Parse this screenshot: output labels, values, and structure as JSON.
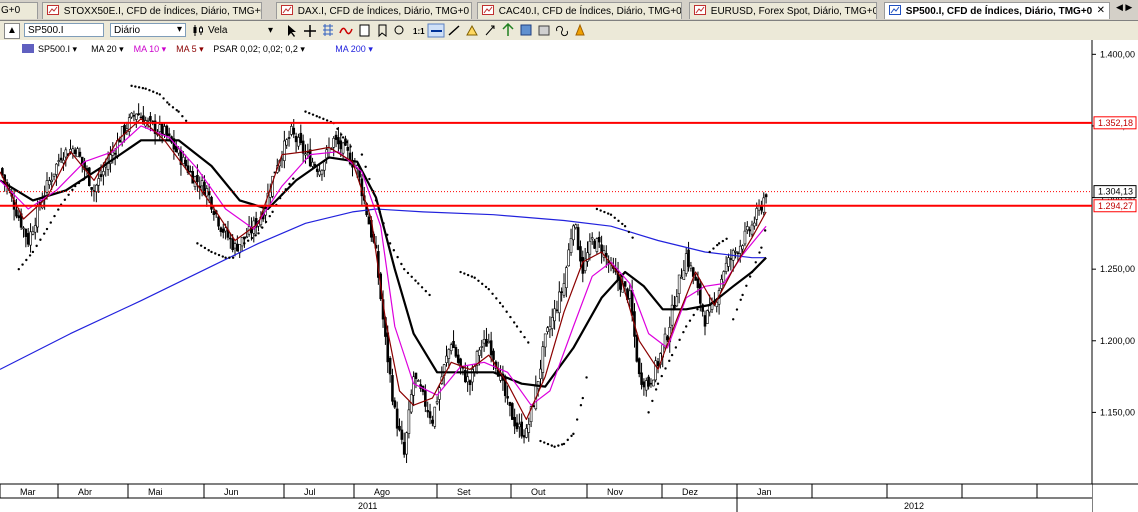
{
  "tabs": [
    {
      "label": "G+0",
      "active": false
    },
    {
      "label": "STOXX50E.I, CFD de Índices, Diário, TMG+0",
      "active": false
    },
    {
      "label": "DAX.I, CFD de Índices, Diário, TMG+0",
      "active": false
    },
    {
      "label": "CAC40.I, CFD de Índices, Diário, TMG+0",
      "active": false
    },
    {
      "label": "EURUSD, Forex Spot, Diário, TMG+0",
      "active": false
    },
    {
      "label": "SP500.I, CFD de Índices, Diário, TMG+0",
      "active": true
    }
  ],
  "tab_close": "✕",
  "nav_arrows": "◀ ▶",
  "toolbar": {
    "symbol": "SP500.I",
    "period": "Diário",
    "chart_type": "Vela",
    "collapse_icon": "▲",
    "tool_icons": [
      "cursor-icon",
      "crosshair-icon",
      "grid-icon",
      "wave-icon",
      "info-icon",
      "bookmark-icon",
      "zoom-icon",
      "ratio-icon",
      "line-icon",
      "draw-icon",
      "object-icon",
      "arrows-icon",
      "scale-icon",
      "save-icon",
      "compare-icon",
      "link-icon",
      "alert-icon"
    ]
  },
  "legend": [
    {
      "text": "SP500.I",
      "color": "#000000"
    },
    {
      "text": "MA 20",
      "color": "#000000"
    },
    {
      "text": "MA 10",
      "color": "#cc00cc"
    },
    {
      "text": "MA 5",
      "color": "#8b0000"
    },
    {
      "text": "PSAR 0,02; 0,02; 0,2",
      "color": "#000000"
    },
    {
      "text": "MA 200",
      "color": "#2222dd"
    }
  ],
  "chart_data": {
    "type": "candlestick",
    "price_range": [
      1100,
      1410
    ],
    "y_ticks": [
      {
        "value": 1400,
        "label": "1.400,00"
      },
      {
        "value": 1350,
        "label": "1.350,00"
      },
      {
        "value": 1300,
        "label": "1.300,00"
      },
      {
        "value": 1250,
        "label": "1.250,00"
      },
      {
        "value": 1200,
        "label": "1.200,00"
      },
      {
        "value": 1150,
        "label": "1.150,00"
      }
    ],
    "horizontal_lines": [
      {
        "value": 1352.18,
        "label": "1.352,18",
        "style": "solid",
        "color": "#ff0000"
      },
      {
        "value": 1294.27,
        "label": "1.294,27",
        "style": "solid",
        "color": "#ff0000"
      },
      {
        "value": 1304.13,
        "label": "1.304,13",
        "style": "dotted",
        "color": "#ff0000"
      }
    ],
    "months": [
      "Mar",
      "Abr",
      "Mai",
      "Jun",
      "Jul",
      "Ago",
      "Set",
      "Out",
      "Nov",
      "Dez",
      "Jan"
    ],
    "years": [
      "2011",
      "2012"
    ],
    "close_path": [
      [
        0,
        1320
      ],
      [
        6,
        1295
      ],
      [
        12,
        1270
      ],
      [
        18,
        1300
      ],
      [
        26,
        1330
      ],
      [
        32,
        1335
      ],
      [
        40,
        1305
      ],
      [
        46,
        1325
      ],
      [
        52,
        1345
      ],
      [
        58,
        1360
      ],
      [
        64,
        1350
      ],
      [
        70,
        1345
      ],
      [
        76,
        1330
      ],
      [
        82,
        1315
      ],
      [
        88,
        1305
      ],
      [
        94,
        1280
      ],
      [
        100,
        1265
      ],
      [
        106,
        1275
      ],
      [
        112,
        1290
      ],
      [
        118,
        1325
      ],
      [
        124,
        1345
      ],
      [
        130,
        1330
      ],
      [
        136,
        1320
      ],
      [
        142,
        1340
      ],
      [
        148,
        1330
      ],
      [
        152,
        1320
      ],
      [
        156,
        1290
      ],
      [
        160,
        1260
      ],
      [
        164,
        1200
      ],
      [
        168,
        1150
      ],
      [
        172,
        1120
      ],
      [
        176,
        1175
      ],
      [
        180,
        1160
      ],
      [
        184,
        1145
      ],
      [
        188,
        1175
      ],
      [
        192,
        1200
      ],
      [
        196,
        1180
      ],
      [
        200,
        1170
      ],
      [
        204,
        1195
      ],
      [
        208,
        1200
      ],
      [
        212,
        1180
      ],
      [
        216,
        1155
      ],
      [
        220,
        1140
      ],
      [
        224,
        1135
      ],
      [
        228,
        1165
      ],
      [
        232,
        1200
      ],
      [
        236,
        1220
      ],
      [
        240,
        1240
      ],
      [
        244,
        1285
      ],
      [
        248,
        1250
      ],
      [
        252,
        1270
      ],
      [
        256,
        1265
      ],
      [
        260,
        1250
      ],
      [
        264,
        1240
      ],
      [
        268,
        1230
      ],
      [
        272,
        1175
      ],
      [
        276,
        1170
      ],
      [
        280,
        1185
      ],
      [
        284,
        1205
      ],
      [
        288,
        1235
      ],
      [
        292,
        1260
      ],
      [
        296,
        1240
      ],
      [
        300,
        1215
      ],
      [
        304,
        1225
      ],
      [
        308,
        1250
      ],
      [
        312,
        1260
      ],
      [
        316,
        1270
      ],
      [
        320,
        1280
      ],
      [
        324,
        1295
      ],
      [
        326,
        1304
      ]
    ],
    "ma5": [
      [
        0,
        1318
      ],
      [
        10,
        1285
      ],
      [
        20,
        1300
      ],
      [
        30,
        1332
      ],
      [
        40,
        1312
      ],
      [
        50,
        1340
      ],
      [
        60,
        1355
      ],
      [
        70,
        1340
      ],
      [
        80,
        1318
      ],
      [
        90,
        1295
      ],
      [
        100,
        1270
      ],
      [
        110,
        1282
      ],
      [
        120,
        1330
      ],
      [
        130,
        1332
      ],
      [
        140,
        1335
      ],
      [
        150,
        1325
      ],
      [
        158,
        1285
      ],
      [
        164,
        1215
      ],
      [
        170,
        1165
      ],
      [
        176,
        1155
      ],
      [
        184,
        1160
      ],
      [
        192,
        1185
      ],
      [
        200,
        1180
      ],
      [
        208,
        1190
      ],
      [
        216,
        1170
      ],
      [
        224,
        1145
      ],
      [
        232,
        1175
      ],
      [
        240,
        1220
      ],
      [
        248,
        1255
      ],
      [
        256,
        1262
      ],
      [
        264,
        1245
      ],
      [
        272,
        1200
      ],
      [
        280,
        1180
      ],
      [
        288,
        1215
      ],
      [
        296,
        1248
      ],
      [
        304,
        1225
      ],
      [
        312,
        1250
      ],
      [
        320,
        1272
      ],
      [
        326,
        1290
      ]
    ],
    "ma10": [
      [
        0,
        1312
      ],
      [
        12,
        1292
      ],
      [
        24,
        1305
      ],
      [
        36,
        1325
      ],
      [
        48,
        1332
      ],
      [
        60,
        1350
      ],
      [
        72,
        1342
      ],
      [
        84,
        1320
      ],
      [
        96,
        1292
      ],
      [
        108,
        1278
      ],
      [
        120,
        1308
      ],
      [
        132,
        1330
      ],
      [
        144,
        1332
      ],
      [
        154,
        1318
      ],
      [
        162,
        1280
      ],
      [
        168,
        1210
      ],
      [
        176,
        1170
      ],
      [
        186,
        1162
      ],
      [
        196,
        1182
      ],
      [
        206,
        1185
      ],
      [
        216,
        1178
      ],
      [
        226,
        1155
      ],
      [
        234,
        1165
      ],
      [
        244,
        1210
      ],
      [
        252,
        1245
      ],
      [
        260,
        1255
      ],
      [
        268,
        1240
      ],
      [
        276,
        1205
      ],
      [
        284,
        1195
      ],
      [
        292,
        1230
      ],
      [
        300,
        1238
      ],
      [
        308,
        1240
      ],
      [
        316,
        1260
      ],
      [
        326,
        1280
      ]
    ],
    "ma20": [
      [
        0,
        1312
      ],
      [
        14,
        1298
      ],
      [
        28,
        1305
      ],
      [
        44,
        1322
      ],
      [
        60,
        1340
      ],
      [
        76,
        1340
      ],
      [
        90,
        1322
      ],
      [
        102,
        1298
      ],
      [
        114,
        1292
      ],
      [
        126,
        1312
      ],
      [
        140,
        1328
      ],
      [
        152,
        1325
      ],
      [
        160,
        1300
      ],
      [
        168,
        1250
      ],
      [
        176,
        1205
      ],
      [
        186,
        1178
      ],
      [
        198,
        1178
      ],
      [
        210,
        1178
      ],
      [
        222,
        1170
      ],
      [
        232,
        1168
      ],
      [
        244,
        1195
      ],
      [
        256,
        1230
      ],
      [
        266,
        1248
      ],
      [
        274,
        1238
      ],
      [
        282,
        1222
      ],
      [
        292,
        1222
      ],
      [
        302,
        1225
      ],
      [
        312,
        1238
      ],
      [
        320,
        1248
      ],
      [
        326,
        1258
      ]
    ],
    "ma200": [
      [
        0,
        1180
      ],
      [
        30,
        1205
      ],
      [
        60,
        1228
      ],
      [
        90,
        1252
      ],
      [
        110,
        1268
      ],
      [
        130,
        1282
      ],
      [
        150,
        1290
      ],
      [
        160,
        1292
      ],
      [
        180,
        1290
      ],
      [
        210,
        1288
      ],
      [
        240,
        1284
      ],
      [
        260,
        1280
      ],
      [
        280,
        1270
      ],
      [
        300,
        1262
      ],
      [
        320,
        1258
      ],
      [
        326,
        1258
      ]
    ],
    "psar_segments": [
      {
        "points": [
          [
            8,
            1250
          ],
          [
            14,
            1262
          ],
          [
            20,
            1278
          ],
          [
            26,
            1295
          ],
          [
            32,
            1308
          ],
          [
            38,
            1316
          ]
        ],
        "side": "below"
      },
      {
        "points": [
          [
            56,
            1378
          ],
          [
            62,
            1376
          ],
          [
            68,
            1372
          ],
          [
            72,
            1365
          ],
          [
            76,
            1360
          ],
          [
            80,
            1352
          ]
        ],
        "side": "above"
      },
      {
        "points": [
          [
            84,
            1268
          ],
          [
            90,
            1262
          ],
          [
            96,
            1258
          ],
          [
            100,
            1258
          ]
        ],
        "side": "below"
      },
      {
        "points": [
          [
            104,
            1268
          ],
          [
            110,
            1275
          ],
          [
            116,
            1290
          ],
          [
            120,
            1302
          ],
          [
            126,
            1316
          ]
        ],
        "side": "below"
      },
      {
        "points": [
          [
            130,
            1360
          ],
          [
            136,
            1356
          ],
          [
            142,
            1352
          ],
          [
            146,
            1342
          ],
          [
            150,
            1334
          ]
        ],
        "side": "above"
      },
      {
        "points": [
          [
            154,
            1330
          ],
          [
            160,
            1298
          ],
          [
            166,
            1268
          ],
          [
            172,
            1250
          ],
          [
            178,
            1240
          ],
          [
            184,
            1230
          ]
        ],
        "side": "above"
      },
      {
        "points": [
          [
            196,
            1248
          ],
          [
            202,
            1244
          ],
          [
            208,
            1236
          ],
          [
            214,
            1224
          ],
          [
            220,
            1210
          ],
          [
            226,
            1196
          ]
        ],
        "side": "above"
      },
      {
        "points": [
          [
            230,
            1130
          ],
          [
            236,
            1126
          ],
          [
            240,
            1128
          ],
          [
            244,
            1135
          ],
          [
            248,
            1160
          ],
          [
            250,
            1178
          ]
        ],
        "side": "below"
      },
      {
        "points": [
          [
            254,
            1292
          ],
          [
            260,
            1288
          ],
          [
            266,
            1280
          ],
          [
            270,
            1270
          ]
        ],
        "side": "above"
      },
      {
        "points": [
          [
            276,
            1150
          ],
          [
            280,
            1170
          ],
          [
            286,
            1190
          ],
          [
            292,
            1210
          ],
          [
            298,
            1225
          ]
        ],
        "side": "below"
      },
      {
        "points": [
          [
            302,
            1262
          ],
          [
            306,
            1268
          ],
          [
            310,
            1272
          ]
        ],
        "side": "above"
      },
      {
        "points": [
          [
            312,
            1215
          ],
          [
            316,
            1232
          ],
          [
            320,
            1248
          ],
          [
            324,
            1265
          ],
          [
            326,
            1280
          ]
        ],
        "side": "below"
      }
    ]
  }
}
